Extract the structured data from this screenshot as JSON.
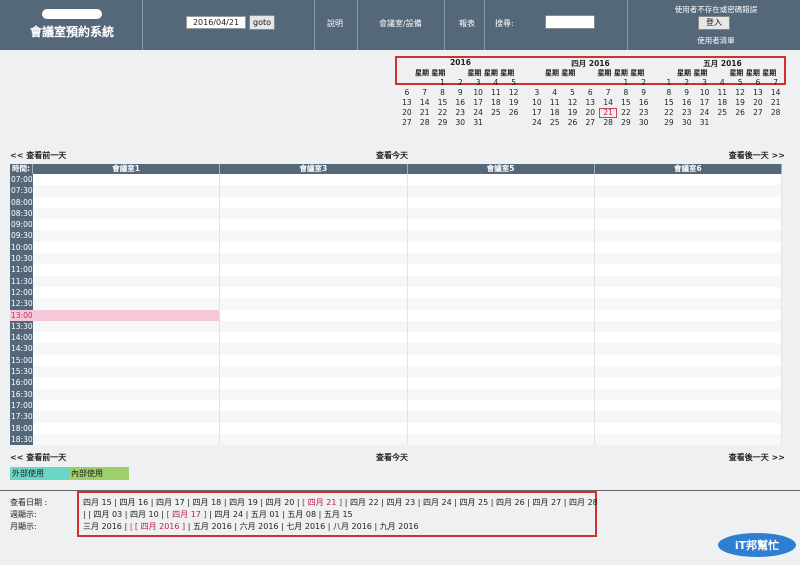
{
  "header": {
    "app_title": "會議室預約系統",
    "date_value": "2016/04/21",
    "goto_label": "goto",
    "help_link": "說明",
    "rooms_link": "會議室/設備",
    "report_link": "報表",
    "search_label": "搜尋:",
    "login_message": "使用者不存在或密碼錯誤",
    "login_label": "登入",
    "user_list_link": "使用者清單"
  },
  "mini_calendars": [
    {
      "title": "2016",
      "weekdays": [
        "",
        "",
        "",
        "",
        "",
        "",
        ""
      ],
      "head_text": "星期 星期",
      "head_text2": "星期 星期 星期",
      "weeks": [
        [
          "",
          "",
          "1",
          "2",
          "3",
          "4",
          "5"
        ],
        [
          "6",
          "7",
          "8",
          "9",
          "10",
          "11",
          "12"
        ],
        [
          "13",
          "14",
          "15",
          "16",
          "17",
          "18",
          "19"
        ],
        [
          "20",
          "21",
          "22",
          "23",
          "24",
          "25",
          "26"
        ],
        [
          "27",
          "28",
          "29",
          "30",
          "31",
          "",
          ""
        ]
      ]
    },
    {
      "title": "四月 2016",
      "head_text": "星期 星期",
      "head_text2": "星期 星期 星期",
      "weeks": [
        [
          "",
          "",
          "",
          "",
          "",
          "1",
          "2"
        ],
        [
          "3",
          "4",
          "5",
          "6",
          "7",
          "8",
          "9"
        ],
        [
          "10",
          "11",
          "12",
          "13",
          "14",
          "15",
          "16"
        ],
        [
          "17",
          "18",
          "19",
          "20",
          "21",
          "22",
          "23"
        ],
        [
          "24",
          "25",
          "26",
          "27",
          "28",
          "29",
          "30"
        ]
      ],
      "today": "21"
    },
    {
      "title": "五月 2016",
      "head_text": "星期 星期",
      "head_text2": "星期 星期 星期",
      "weeks": [
        [
          "1",
          "2",
          "3",
          "4",
          "5",
          "6",
          "7"
        ],
        [
          "8",
          "9",
          "10",
          "11",
          "12",
          "13",
          "14"
        ],
        [
          "15",
          "16",
          "17",
          "18",
          "19",
          "20",
          "21"
        ],
        [
          "22",
          "23",
          "24",
          "25",
          "26",
          "27",
          "28"
        ],
        [
          "29",
          "30",
          "31",
          "",
          "",
          "",
          ""
        ]
      ]
    }
  ],
  "nav": {
    "prev_day": "<< 查看前一天",
    "today": "查看今天",
    "next_day": "查看後一天 >>"
  },
  "grid": {
    "time_header": "時間:",
    "rooms": [
      "會議室1",
      "會議室3",
      "會議室5",
      "會議室6"
    ],
    "times": [
      "07:00",
      "07:30",
      "08:00",
      "08:30",
      "09:00",
      "09:30",
      "10:00",
      "10:30",
      "11:00",
      "11:30",
      "12:00",
      "12:30",
      "13:00",
      "13:30",
      "14:00",
      "14:30",
      "15:00",
      "15:30",
      "16:00",
      "16:30",
      "17:00",
      "17:30",
      "18:00",
      "18:30"
    ],
    "highlight_time": "13:00",
    "highlight_color": "#f6c8da"
  },
  "legend": {
    "external": "外部使用",
    "internal": "內部使用",
    "external_color": "#6cd6c6",
    "internal_color": "#9fcf6a"
  },
  "bottom": {
    "view_date_label": "查看日期 :",
    "week_label": "週顯示:",
    "month_label": "月顯示:",
    "days": [
      "四月 15",
      "四月 16",
      "四月 17",
      "四月 18",
      "四月 19",
      "四月 20",
      "[ 四月 21 ]",
      "四月 22",
      "四月 23",
      "四月 24",
      "四月 25",
      "四月 26",
      "四月 27",
      "四月 28"
    ],
    "weeks_prefix": "| |",
    "weeks": [
      "四月 03",
      "四月 10",
      "[ 四月 17 ]",
      "四月 24",
      "五月 01",
      "五月 08",
      "五月 15"
    ],
    "months_prefix": "",
    "months": [
      "三月 2016",
      "| [ 四月 2016 ]",
      "五月 2016",
      "六月 2016",
      "七月 2016",
      "八月 2016",
      "九月 2016"
    ]
  },
  "watermark": {
    "text": "iT邦幫忙",
    "color": "#2e7fd0"
  }
}
